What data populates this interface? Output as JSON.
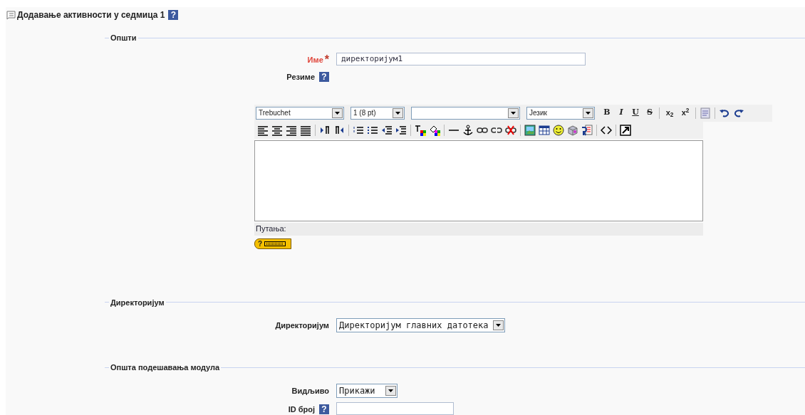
{
  "heading": {
    "title": "Додавање активности у седмица 1",
    "help": "?"
  },
  "general": {
    "legend": "Општи",
    "name_field": {
      "label": "Име",
      "required_mark": "*",
      "value": "директоријум1"
    },
    "summary": {
      "label": "Резиме",
      "help": "?"
    },
    "editor": {
      "selects": [
        "Trebuchet",
        "1 (8 pt)",
        "Језик"
      ],
      "format_buttons": [
        "B",
        "I",
        "U",
        "S"
      ],
      "script_buttons": [
        "x$_{2}$",
        "x$^{2}$"
      ],
      "path_label": "Путања:",
      "help_badge": "?"
    }
  },
  "directory": {
    "legend": "Директоријум",
    "label": "Директоријум",
    "value": "Директоријум главних датотека"
  },
  "module": {
    "legend": "Општа подешавања модула",
    "visible": {
      "label": "Видљиво",
      "value": "Прикажи"
    },
    "id_number": {
      "label": "ID број",
      "help": "?"
    }
  }
}
